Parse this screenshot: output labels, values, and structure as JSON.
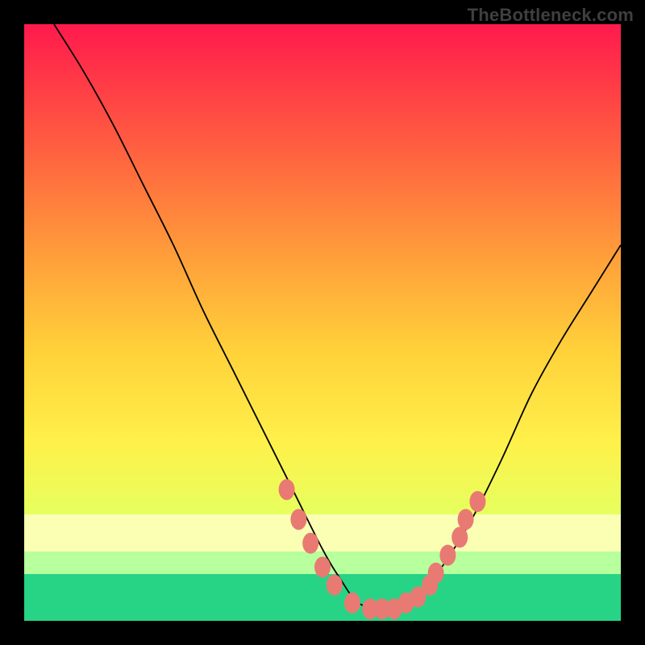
{
  "brand": "TheBottleneck.com",
  "chart_data": {
    "type": "line",
    "title": "",
    "xlabel": "",
    "ylabel": "",
    "xlim": [
      0,
      100
    ],
    "ylim": [
      0,
      100
    ],
    "series": [
      {
        "name": "bottleneck-curve",
        "x": [
          5,
          10,
          15,
          20,
          25,
          30,
          35,
          40,
          45,
          50,
          53,
          56,
          60,
          63,
          66,
          70,
          75,
          80,
          85,
          90,
          95,
          100
        ],
        "values": [
          100,
          92,
          83,
          73,
          63,
          52,
          42,
          32,
          22,
          12,
          7,
          3,
          2,
          2,
          4,
          9,
          17,
          27,
          38,
          47,
          55,
          63
        ]
      }
    ],
    "markers": {
      "name": "highlight-points",
      "x": [
        44,
        46,
        48,
        50,
        52,
        55,
        58,
        60,
        62,
        64,
        66,
        68,
        69,
        71,
        73,
        74,
        76
      ],
      "values": [
        22,
        17,
        13,
        9,
        6,
        3,
        2,
        2,
        2,
        3,
        4,
        6,
        8,
        11,
        14,
        17,
        20
      ]
    }
  }
}
